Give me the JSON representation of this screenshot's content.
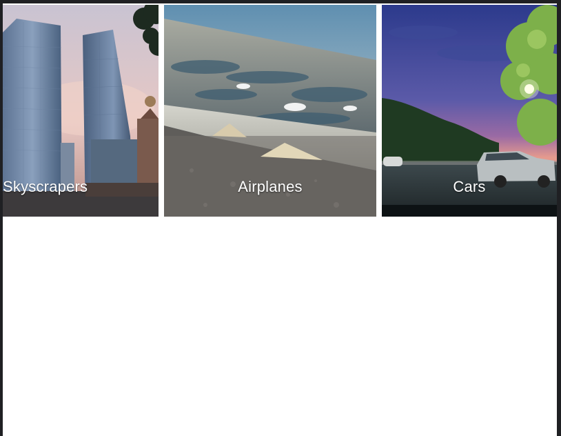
{
  "tiles": [
    {
      "label": "Skyscrapers",
      "scene": "skyscrapers-photo"
    },
    {
      "label": "Airplanes",
      "scene": "airplane-wing-photo"
    },
    {
      "label": "Cars",
      "scene": "car-at-dusk-photo"
    }
  ]
}
